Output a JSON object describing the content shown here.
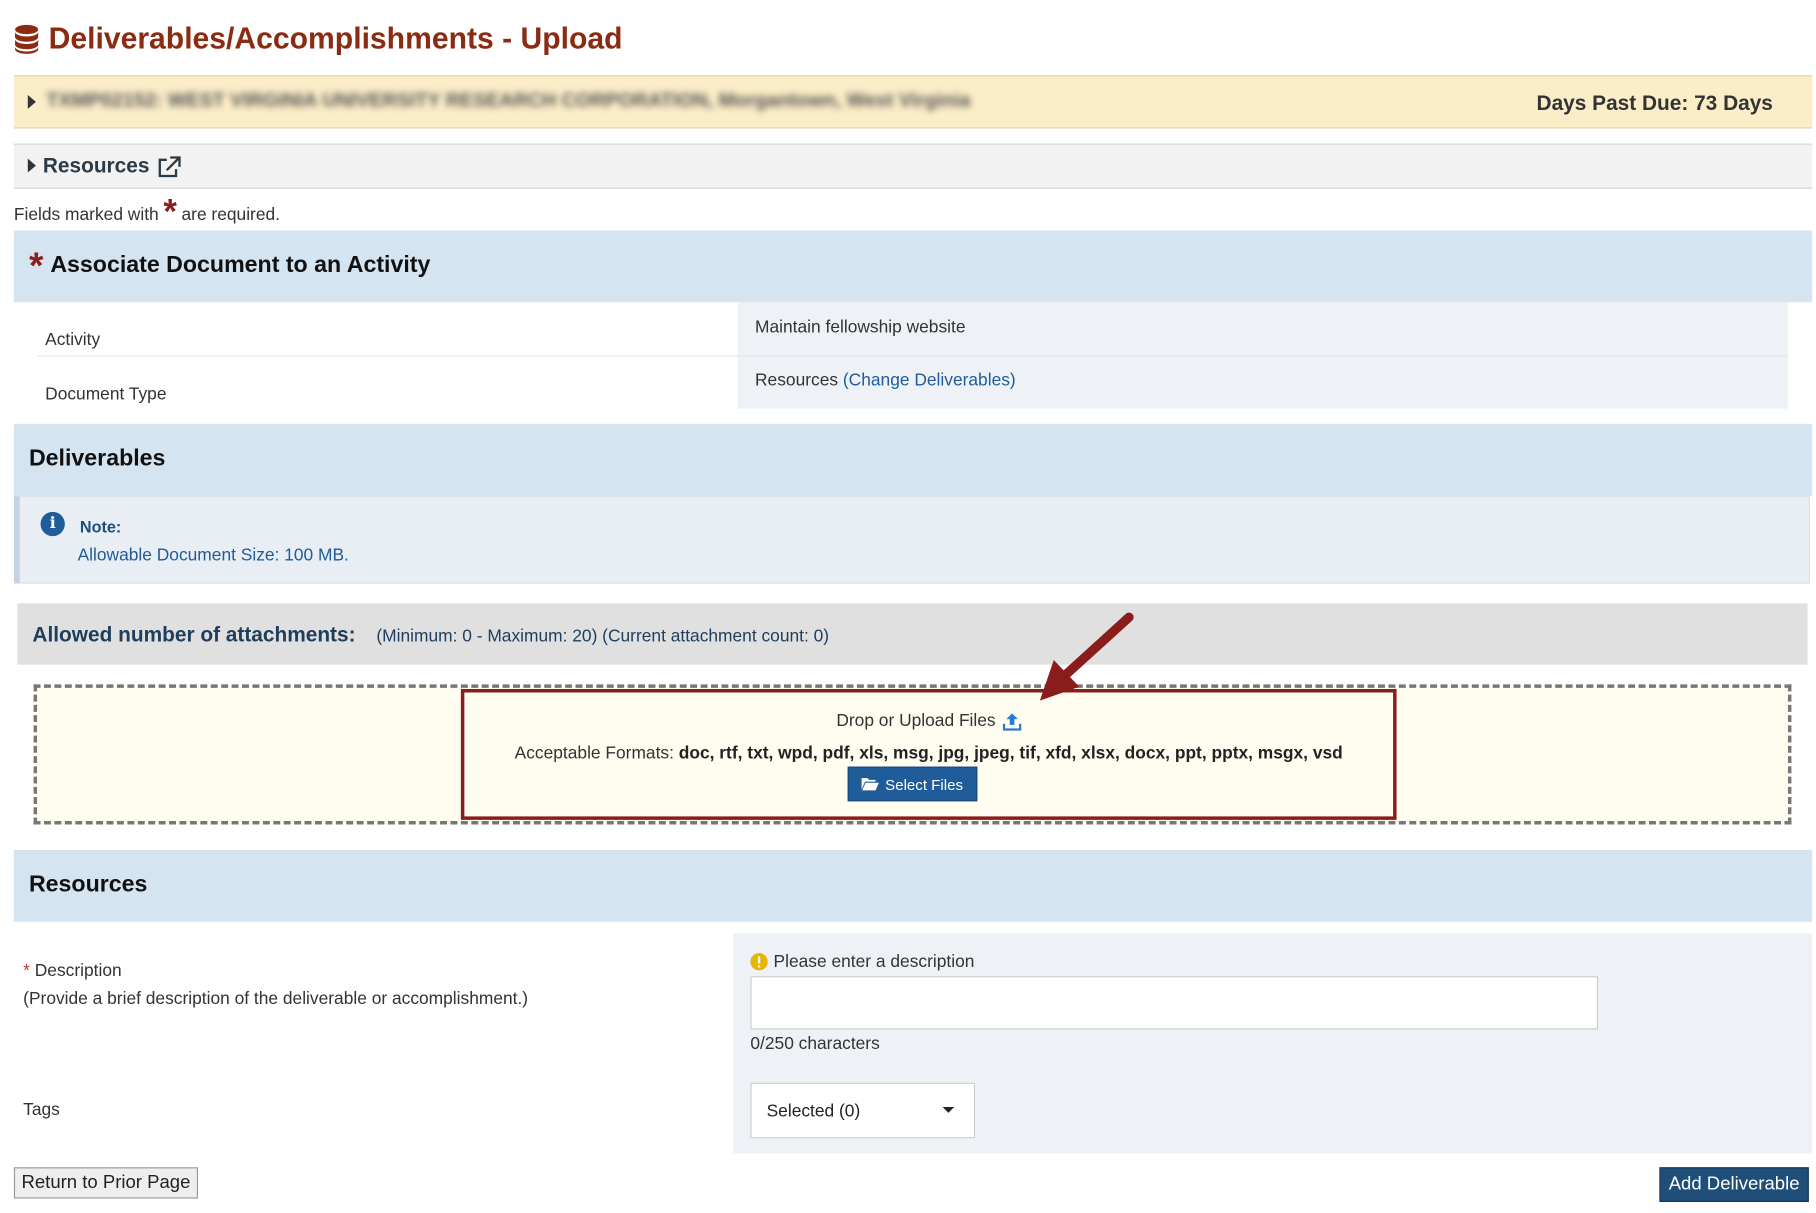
{
  "page": {
    "title": "Deliverables/Accomplishments - Upload",
    "title_icon": "database-icon",
    "accent_color": "#8a2b12"
  },
  "org_bar": {
    "name": "TXMP02152: WEST VIRGINIA UNIVERSITY RESEARCH CORPORATION, Morgantown, West Virginia",
    "days_past_due": "Days Past Due: 73 Days"
  },
  "resources_toggle": {
    "label": "Resources",
    "icon": "external-link-icon"
  },
  "required_note": {
    "prefix": "Fields marked with",
    "star": "*",
    "suffix": "are required."
  },
  "associate": {
    "star": "*",
    "title": "Associate Document to an Activity",
    "activity_label": "Activity",
    "activity_value": "Maintain fellowship website",
    "doctype_label": "Document Type",
    "doctype_value": "Resources",
    "doctype_link": "(Change Deliverables)"
  },
  "deliverables": {
    "title": "Deliverables",
    "note_label": "Note:",
    "note_text": "Allowable Document Size: 100 MB."
  },
  "attachments": {
    "title": "Allowed number of attachments:",
    "info": "(Minimum: 0 - Maximum: 20) (Current attachment count: 0)"
  },
  "upload": {
    "drop_text": "Drop or Upload Files",
    "formats_label": "Acceptable Formats:",
    "formats": "doc, rtf, txt, wpd, pdf, xls, msg, jpg, jpeg, tif, xfd, xlsx, docx, ppt, pptx, msgx, vsd",
    "select_button": "Select Files"
  },
  "resources": {
    "title": "Resources",
    "desc_star": "*",
    "desc_label": "Description",
    "desc_help": "(Provide a brief description of the deliverable or accomplishment.)",
    "desc_warning": "Please enter a description",
    "desc_value": "",
    "char_count": "0/250 characters",
    "tags_label": "Tags",
    "tags_value": "Selected (0)"
  },
  "footer": {
    "return_button": "Return to Prior Page",
    "add_button": "Add Deliverable"
  }
}
